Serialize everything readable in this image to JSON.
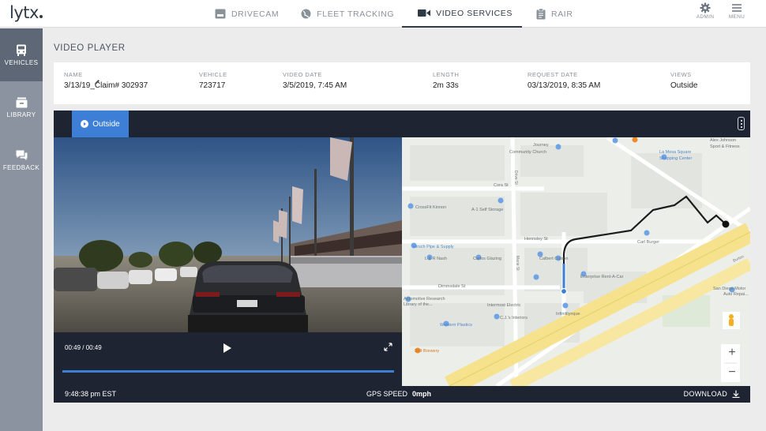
{
  "app": {
    "logo": "lytx"
  },
  "nav": {
    "items": [
      {
        "label": "DRIVECAM",
        "icon": "drivecam-icon"
      },
      {
        "label": "FLEET TRACKING",
        "icon": "globe-icon"
      },
      {
        "label": "VIDEO SERVICES",
        "icon": "video-camera-icon",
        "active": true
      },
      {
        "label": "RAIR",
        "icon": "clipboard-icon"
      }
    ],
    "admin_label": "ADMIN",
    "menu_label": "MENU"
  },
  "sidebar": {
    "items": [
      {
        "label": "VEHICLES",
        "icon": "bus-icon",
        "active": true
      },
      {
        "label": "LIBRARY",
        "icon": "library-icon"
      },
      {
        "label": "FEEDBACK",
        "icon": "chat-icon"
      }
    ]
  },
  "page": {
    "title": "VIDEO PLAYER"
  },
  "info": {
    "name": {
      "label": "NAME",
      "value": "3/13/19_Claim# 302937"
    },
    "vehicle": {
      "label": "VEHICLE",
      "value": "723717"
    },
    "video_date": {
      "label": "VIDEO DATE",
      "value": "3/5/2019, 7:45 AM"
    },
    "length": {
      "label": "LENGTH",
      "value": "2m 33s"
    },
    "request_date": {
      "label": "REQUEST DATE",
      "value": "03/13/2019, 8:35 AM"
    },
    "views": {
      "label": "VIEWS",
      "value": "Outside"
    }
  },
  "player": {
    "tab_label": "Outside",
    "time": "00:49 / 00:49",
    "progress": 1.0,
    "clock": "9:48:38 pm EST",
    "gps_label": "GPS SPEED",
    "gps_value": "0mph",
    "download_label": "DOWNLOAD"
  },
  "map": {
    "labels": {
      "journey": "Journey",
      "community": "Community Church",
      "alex": "Alex Johnson",
      "sport": "Sport & Fitness",
      "lamesa": "La Mesa Square",
      "shopping": "Shopping Center",
      "cora": "Cora St",
      "crossfit": "CrossFit Kinnon",
      "a1": "A-1 Self Storage",
      "hirsch": "Hirsch Pipe & Supply",
      "hennsley": "Hennsley St",
      "lrnash": "L & R Nash",
      "carlos": "Carlos Glazing",
      "calbert": "Calbert Colson",
      "carl": "Carl Burger",
      "enterprise": "Enterprise Rent-A-Car",
      "dorsey": "Dimmsdale St",
      "automotive": "Automotive Research",
      "library": "Library of the...",
      "intermost": "Intermost Electric",
      "cjs": "C.J.'s Interiors",
      "infinite": "Infinitilynque",
      "western": "Western Plastics",
      "sdmotor": "San Diego Motor",
      "autorep": "Auto Repai...",
      "belt": "Belt Brewery",
      "drive": "Drive St",
      "marie": "Marie St",
      "burton": "Burton"
    },
    "zoom_in": "+",
    "zoom_out": "−"
  },
  "colors": {
    "accent": "#3d7fd6",
    "dark": "#1f2432",
    "sidebar": "#8a939f",
    "sidebar_active": "#5d6775"
  }
}
